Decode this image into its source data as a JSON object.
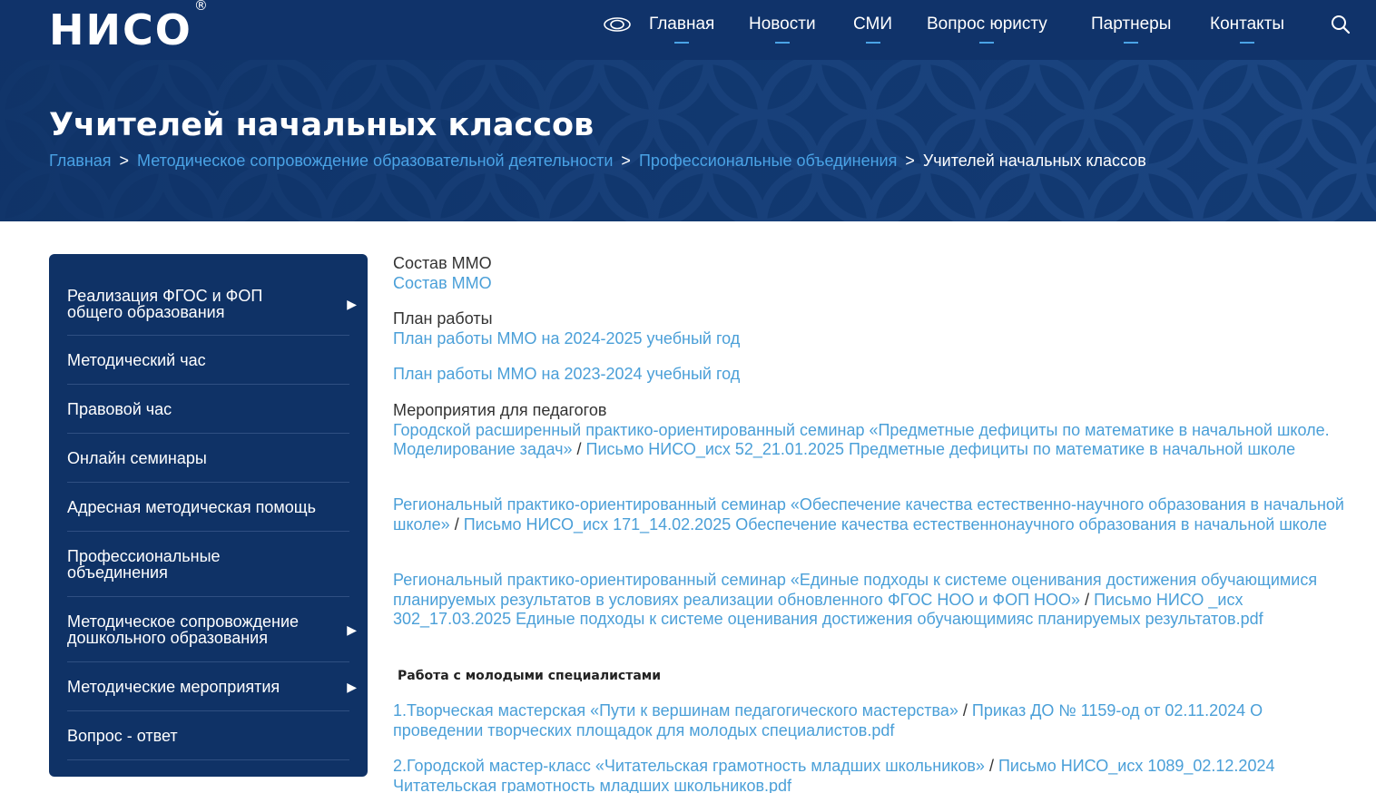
{
  "header": {
    "logo": "НИСО",
    "logo_mark": "®",
    "nav": [
      "Главная",
      "Новости",
      "СМИ",
      "Вопрос юристу",
      "Партнеры",
      "Контакты"
    ],
    "title": "Учителей начальных классов",
    "breadcrumb": {
      "items": [
        "Главная",
        "Методическое сопровождение образовательной деятельности",
        "Профессиональные объединения"
      ],
      "separator": ">",
      "current": "Учителей начальных классов"
    }
  },
  "sidebar": {
    "items": [
      {
        "label": "Реализация ФГОС и ФОП общего образования",
        "arrow": "▶"
      },
      {
        "label": "Методический час",
        "arrow": ""
      },
      {
        "label": "Правовой час",
        "arrow": ""
      },
      {
        "label": "Онлайн семинары",
        "arrow": ""
      },
      {
        "label": "Адресная методическая помощь",
        "arrow": ""
      },
      {
        "label": "Профессиональные объединения",
        "arrow": ""
      },
      {
        "label": "Методическое сопровождение дошкольного образования",
        "arrow": "▶"
      },
      {
        "label": "Методические мероприятия",
        "arrow": "▶"
      },
      {
        "label": "Вопрос - ответ",
        "arrow": ""
      }
    ]
  },
  "content": {
    "sostav_label": "Состав ММО",
    "sostav_link": "Состав ММО",
    "plan_label": "План работы",
    "plan_link_1": "План работы ММО на 2024-2025 учебный год",
    "plan_link_2": "План работы ММО на 2023-2024 учебный год",
    "events_label": "Мероприятия для педагогов",
    "separator": "/",
    "event_1_seminar": "Городской расширенный практико-ориентированный семинар «Предметные дефициты по математике в начальной школе. Моделирование задач»",
    "event_1_letter": "Письмо НИСО_исх 52_21.01.2025 Предметные дефициты по математике в начальной школе",
    "event_2_seminar": "Региональный практико-ориентированный семинар «Обеспечение качества естественно-научного образования в начальной школе»",
    "event_2_letter": "Письмо НИСО_исх 171_14.02.2025 Обеспечение качества естественнонаучного образования в начальной школе",
    "event_3_seminar": "Региональный практико-ориентированный семинар «Единые подходы к системе оценивания достижения обучающимися планируемых результатов в условиях реализации обновленного ФГОС НОО и ФОП НОО»",
    "event_3_letter": "Письмо НИСО _исх 302_17.03.2025 Единые подходы к системе оценивания достижения обучающимияс планируемых результатов.pdf",
    "young_heading": "Работа с молодыми специалистами",
    "young_1_event": "1.Творческая мастерская «Пути к вершинам педагогического мастерства»",
    "young_1_doc": "Приказ ДО № 1159-од от 02.11.2024 О проведении творческих площадок для молодых специалистов.pdf",
    "young_2_event": "2.Городской мастер-класс «Читательская грамотность младших школьников»",
    "young_2_doc": "Письмо НИСО_исх 1089_02.12.2024 Читательская грамотность младших школьников.pdf"
  },
  "colors": {
    "header_bg": "#0f3266",
    "link": "#4a9fd8",
    "accent": "#4aa3e6"
  }
}
